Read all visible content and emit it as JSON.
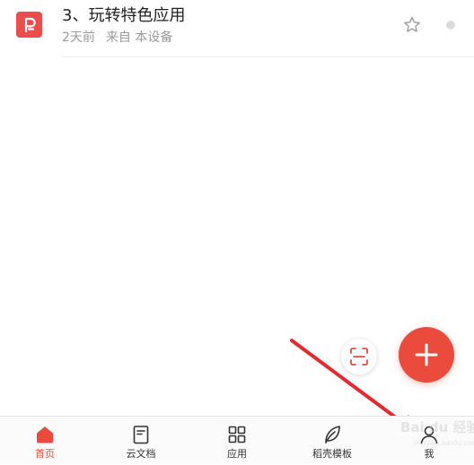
{
  "file_list": {
    "items": [
      {
        "title": "3、玩转特色应用",
        "time": "2天前",
        "source": "来自 本设备",
        "icon": "wps-presentation-icon"
      }
    ]
  },
  "fab": {
    "scan_icon": "scan-icon",
    "add_icon": "plus-icon"
  },
  "tab_bar": {
    "tabs": [
      {
        "label": "首页",
        "icon": "home-icon",
        "active": true
      },
      {
        "label": "云文档",
        "icon": "cloud-doc-icon",
        "active": false
      },
      {
        "label": "应用",
        "icon": "apps-grid-icon",
        "active": false
      },
      {
        "label": "稻壳模板",
        "icon": "leaf-icon",
        "active": false
      },
      {
        "label": "我",
        "icon": "user-icon",
        "active": false
      }
    ]
  },
  "watermark": {
    "main": "Bai du 经验",
    "sub": "jingyan.baidu.com"
  },
  "colors": {
    "accent": "#ea4b3d",
    "file_icon": "#ec4c4c",
    "annotation_arrow": "#e8282d"
  }
}
